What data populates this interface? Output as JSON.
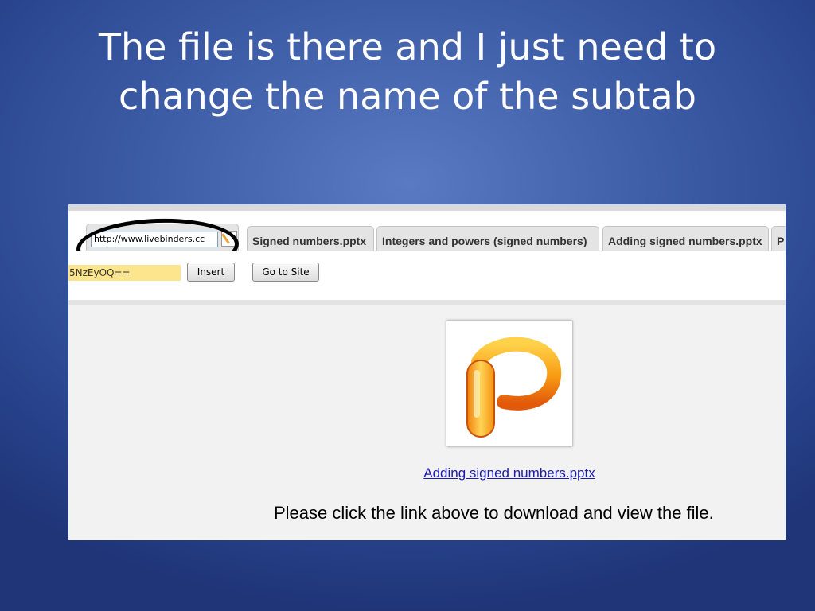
{
  "slide": {
    "title_line1": "The file is there and I just need to",
    "title_line2": "change the name of the subtab"
  },
  "tabs": {
    "url_value": "http://www.livebinders.cc",
    "items": [
      {
        "label": "Signed numbers.pptx"
      },
      {
        "label": "Integers and powers (signed numbers)"
      },
      {
        "label": "Adding signed numbers.pptx"
      },
      {
        "label": "P"
      }
    ]
  },
  "toolbar": {
    "code_value": "5NzEyOQ==",
    "insert_label": "Insert",
    "goto_label": "Go to Site"
  },
  "content": {
    "file_icon": "powerpoint-icon",
    "file_link": "Adding signed numbers.pptx",
    "instruction": "Please click the link above to download and view the file."
  },
  "colors": {
    "background": "#3f5ea8",
    "highlight": "#fde58d",
    "link": "#1b1bb0"
  }
}
